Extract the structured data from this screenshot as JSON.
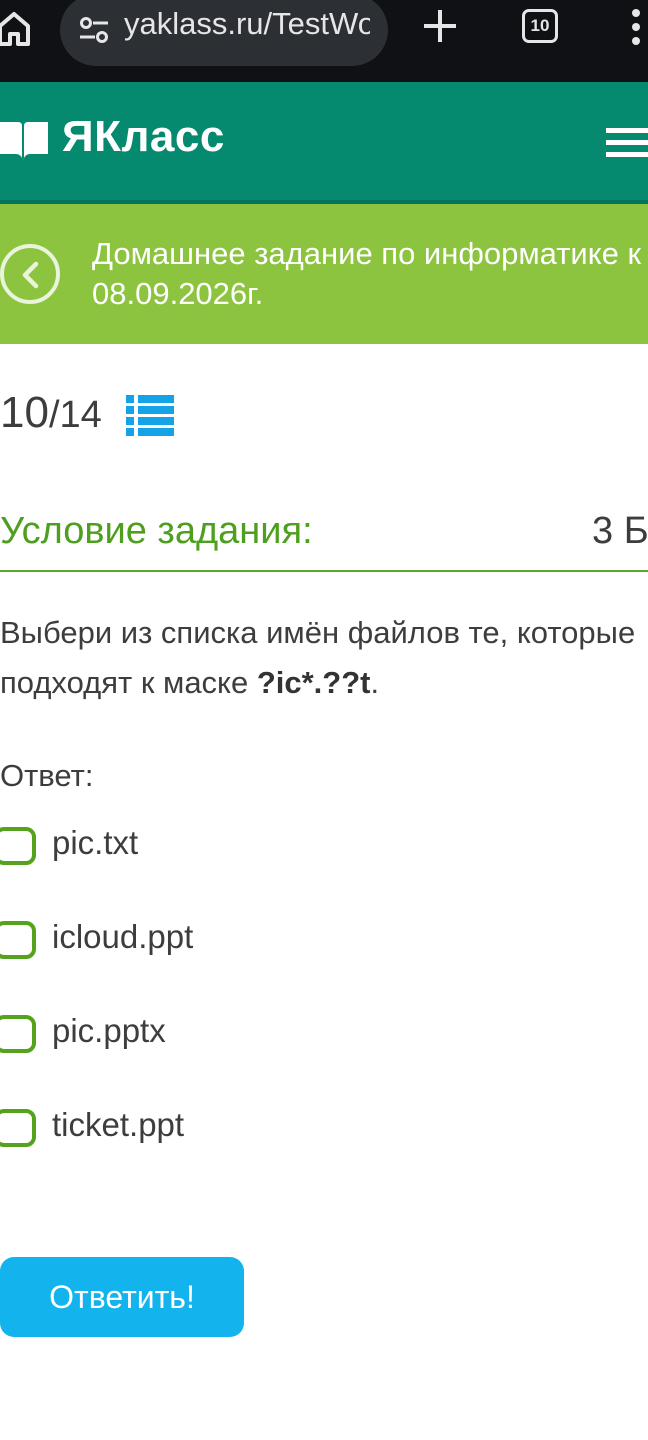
{
  "browser": {
    "url": "yaklass.ru/TestWork",
    "tab_count": "10"
  },
  "header": {
    "logo_text": "ЯКласс"
  },
  "banner": {
    "title_line1": "Домашнее задание по информатике к",
    "title_line2": "08.09.2026г."
  },
  "progress": {
    "current": "10",
    "total": "/14"
  },
  "task": {
    "section_title": "Условие задания:",
    "points": "3 Б.",
    "question_text": "Выбери из списка имён файлов те, которые подходят к маске ",
    "mask": "?ic*.??t",
    "question_end": "."
  },
  "answer": {
    "label": "Ответ:",
    "options": [
      {
        "label": "pic.txt",
        "checked": false
      },
      {
        "label": "icloud.ppt",
        "checked": false
      },
      {
        "label": "pic.pptx",
        "checked": false
      },
      {
        "label": "ticket.ppt",
        "checked": false
      }
    ]
  },
  "submit": {
    "label": "Ответить!"
  },
  "colors": {
    "header": "#058a6f",
    "banner": "#8cc43f",
    "accent_green": "#4e9f1f",
    "button": "#13b4ee"
  },
  "icons": {
    "home": "home-icon",
    "site_settings": "tune-icon",
    "new_tab": "plus-icon",
    "browser_menu": "more-vert-icon",
    "logo": "book-icon",
    "menu": "hamburger-icon",
    "back": "chevron-left-icon",
    "task_list": "list-icon"
  }
}
